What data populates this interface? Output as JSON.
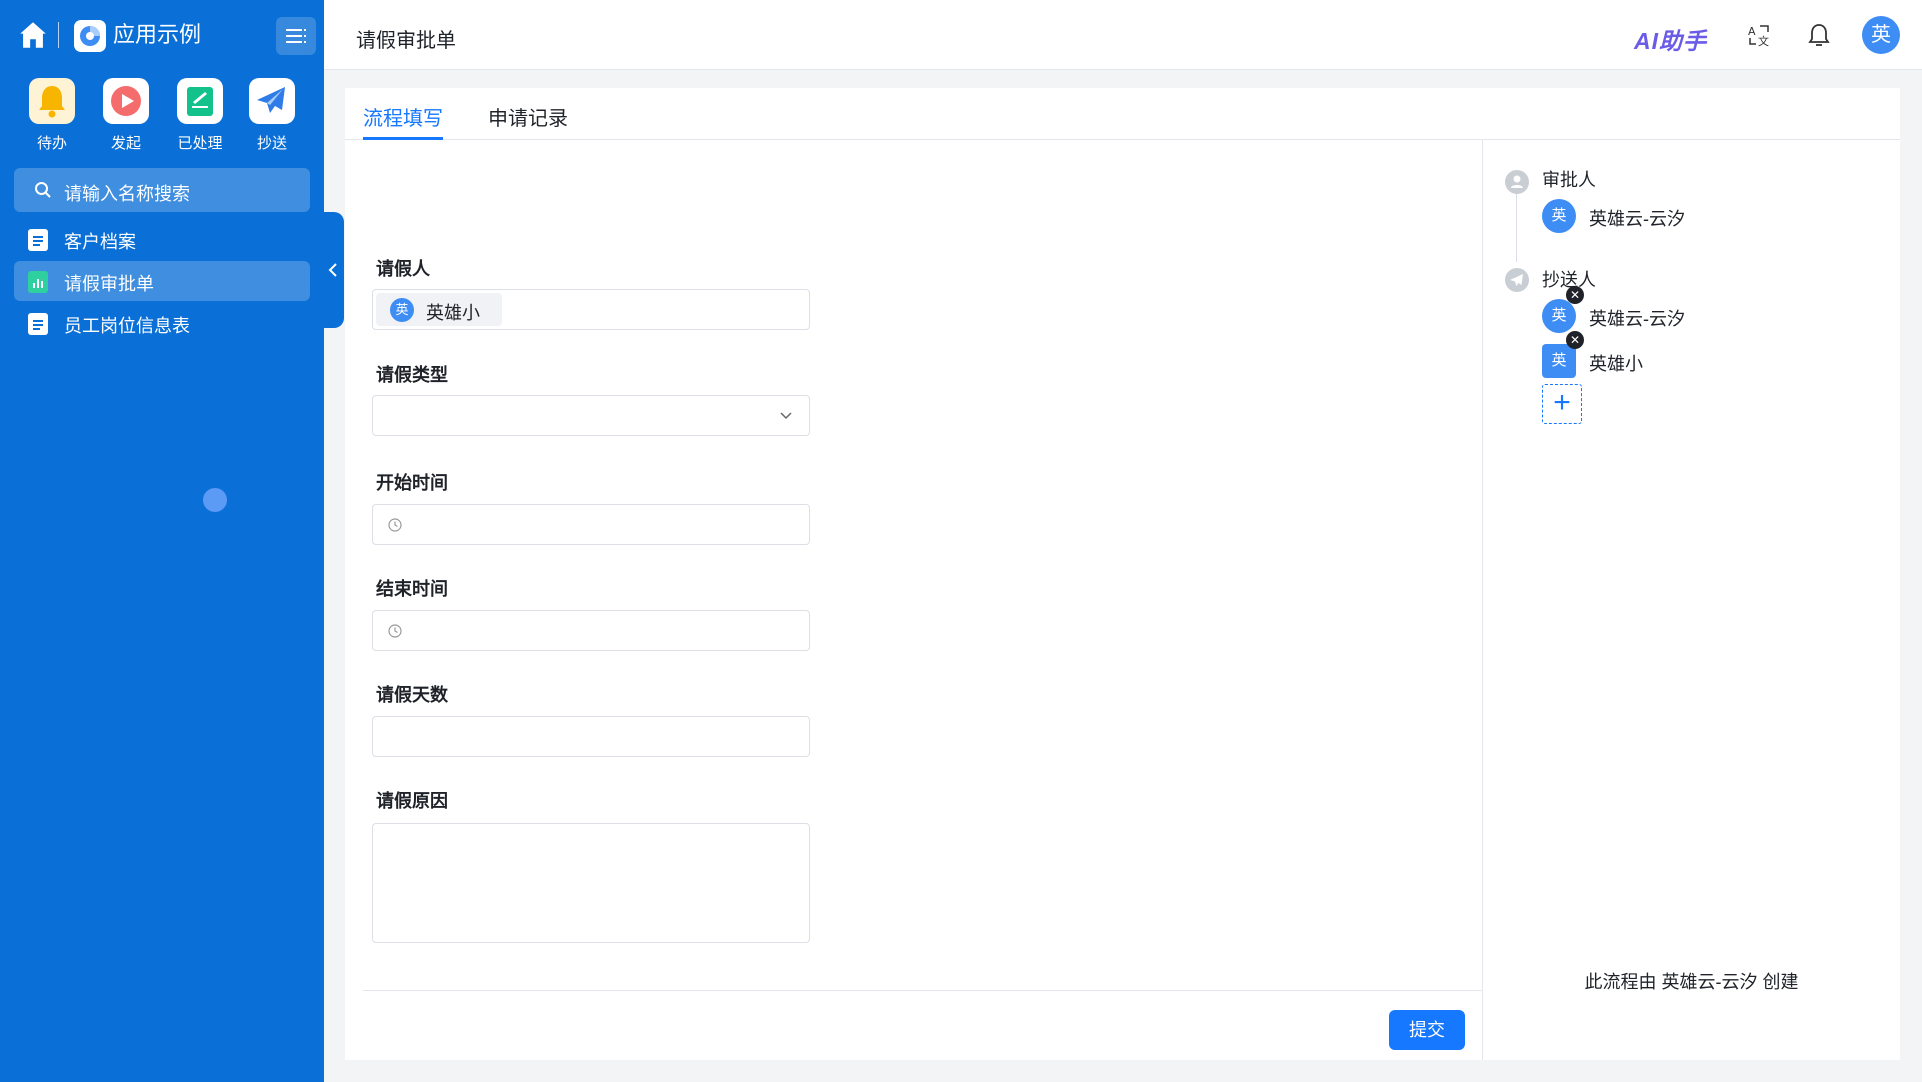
{
  "colors": {
    "sidebar": "#0a6fd6",
    "accent": "#1677ff",
    "avatar": "#3d8df5"
  },
  "sidebar": {
    "app_name": "应用示例",
    "quick_actions": [
      {
        "label": "待办",
        "icon": "bell-icon"
      },
      {
        "label": "发起",
        "icon": "play-icon"
      },
      {
        "label": "已处理",
        "icon": "processed-icon"
      },
      {
        "label": "抄送",
        "icon": "send-icon"
      }
    ],
    "search_placeholder": "请输入名称搜索",
    "nav": [
      {
        "label": "客户档案"
      },
      {
        "label": "请假审批单"
      },
      {
        "label": "员工岗位信息表"
      }
    ]
  },
  "header": {
    "title": "请假审批单",
    "ai_label": "AI助手",
    "avatar": "英"
  },
  "tabs": [
    "流程填写",
    "申请记录"
  ],
  "form": {
    "applicant_label": "请假人",
    "applicant": {
      "avatar": "英",
      "name": "英雄小"
    },
    "type_label": "请假类型",
    "start_label": "开始时间",
    "end_label": "结束时间",
    "days_label": "请假天数",
    "reason_label": "请假原因",
    "submit": "提交"
  },
  "process": {
    "approver_title": "审批人",
    "approver": {
      "avatar": "英",
      "name": "英雄云-云汐"
    },
    "cc_title": "抄送人",
    "cc": [
      {
        "avatar": "英",
        "name": "英雄云-云汐"
      },
      {
        "avatar": "英",
        "name": "英雄小"
      }
    ],
    "remove_symbol": "✕",
    "add_symbol": "+",
    "creator_text": "此流程由 英雄云-云汐 创建"
  }
}
